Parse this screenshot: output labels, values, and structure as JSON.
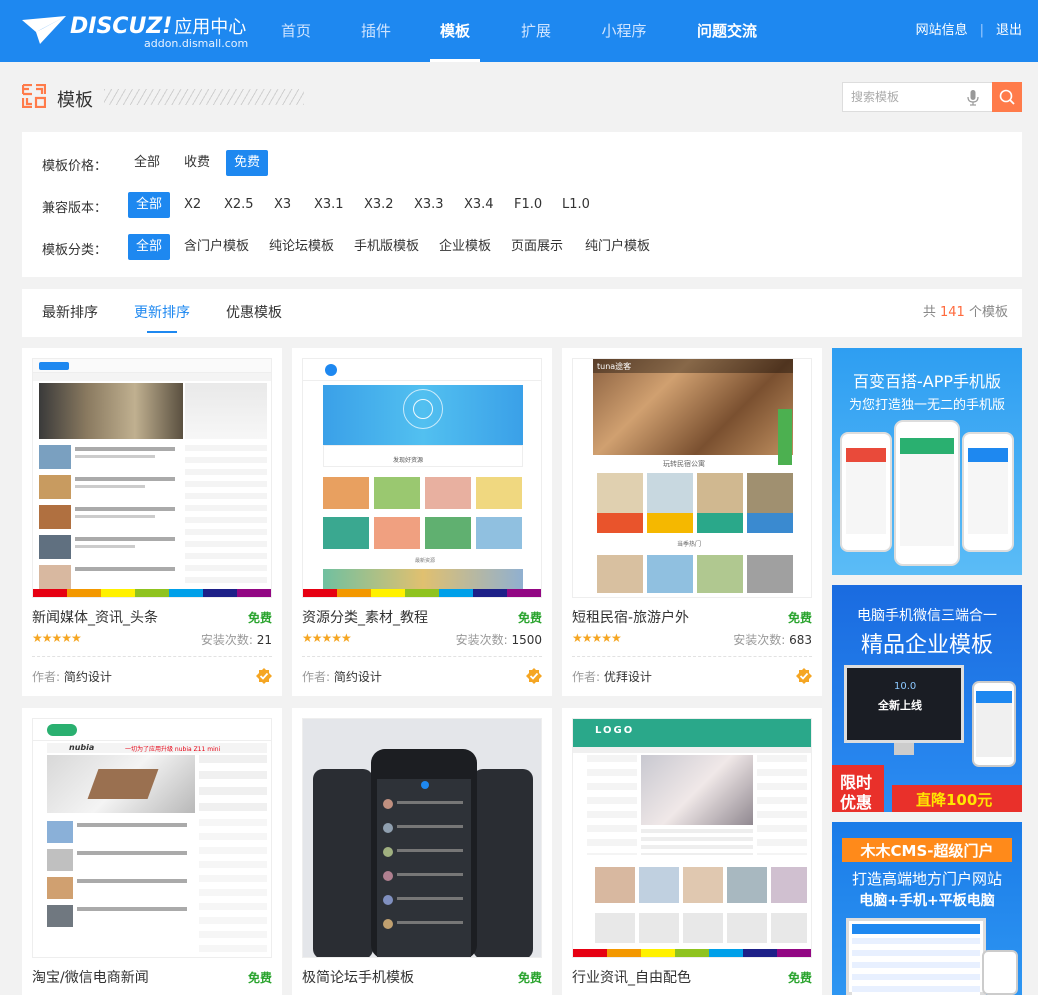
{
  "header": {
    "logo_text": "DISCUZ!",
    "logo_cn": "应用中心",
    "logo_sub": "addon.dismall.com",
    "nav": [
      {
        "label": "首页"
      },
      {
        "label": "插件"
      },
      {
        "label": "模板"
      },
      {
        "label": "扩展"
      },
      {
        "label": "小程序"
      },
      {
        "label": "问题交流"
      }
    ],
    "site_info": "网站信息",
    "sep": "|",
    "logout": "退出"
  },
  "page": {
    "title": "模板",
    "search_placeholder": "搜索模板"
  },
  "filters": {
    "price": {
      "label": "模板价格：",
      "options": [
        "全部",
        "收费",
        "免费"
      ],
      "active": "免费"
    },
    "version": {
      "label": "兼容版本：",
      "options": [
        "全部",
        "X2",
        "X2.5",
        "X3",
        "X3.1",
        "X3.2",
        "X3.3",
        "X3.4",
        "F1.0",
        "L1.0"
      ],
      "active": "全部"
    },
    "category": {
      "label": "模板分类：",
      "options": [
        "全部",
        "含门户模板",
        "纯论坛模板",
        "手机版模板",
        "企业模板",
        "页面展示",
        "纯门户模板"
      ],
      "active": "全部"
    }
  },
  "sort": {
    "items": [
      "最新排序",
      "更新排序",
      "优惠模板"
    ],
    "active": "更新排序",
    "count_prefix": "共",
    "count": "141",
    "count_suffix": "个模板"
  },
  "cards": [
    {
      "name": "新闻媒体_资讯_头条",
      "price": "免费",
      "stars": "★★★★★",
      "installs_label": "安装次数:",
      "installs": "21",
      "author_label": "作者:",
      "author": "简约设计"
    },
    {
      "name": "资源分类_素材_教程",
      "price": "免费",
      "stars": "★★★★★",
      "installs_label": "安装次数:",
      "installs": "1500",
      "author_label": "作者:",
      "author": "简约设计"
    },
    {
      "name": "短租民宿-旅游户外",
      "price": "免费",
      "stars": "★★★★★",
      "installs_label": "安装次数:",
      "installs": "683",
      "author_label": "作者:",
      "author": "优拜设计"
    },
    {
      "name": "淘宝/微信电商新闻",
      "price": "免费"
    },
    {
      "name": "极简论坛手机模板",
      "price": "免费"
    },
    {
      "name": "行业资讯_自由配色",
      "price": "免费"
    }
  ],
  "thumb_text": {
    "tuna": "tuna途客",
    "tuna_section": "玩转民宿公寓",
    "tuna_section2": "当季热门",
    "res_section": "发现好资源",
    "res_section2": "最新资源",
    "nubia": "nubia",
    "nubia_slogan": "一切为了应用升级 nubia Z11 mini",
    "logo_word": "LOGO"
  },
  "ads": [
    {
      "line1": "百变百搭-APP手机版",
      "line2": "为您打造独一无二的手机版"
    },
    {
      "line1": "电脑手机微信三端合一",
      "line2": "精品企业模板",
      "screen_line1": "10.0",
      "screen_line2": "全新上线",
      "badge1": "限时",
      "badge2": "优惠",
      "discount": "直降100元"
    },
    {
      "line1": "木木CMS-超级门户",
      "line2": "打造高端地方门户网站",
      "line3": "电脑+手机+平板电脑"
    }
  ],
  "colors": {
    "primary": "#1e88f0",
    "accent": "#ff7b4a",
    "free_green": "#2aa42e",
    "count_orange": "#ff6a3d",
    "star": "#f5a623"
  },
  "icons": [
    "logo-plane-icon",
    "template-grid-icon",
    "mic-icon",
    "search-icon",
    "verified-icon"
  ]
}
